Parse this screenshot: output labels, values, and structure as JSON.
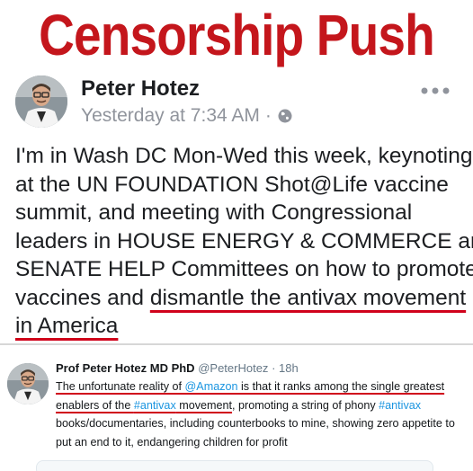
{
  "headline": {
    "text": "Censorship Push",
    "color": "#c4161c"
  },
  "facebook_post": {
    "author": "Peter Hotez",
    "timestamp": "Yesterday at 7:34 AM",
    "separator": "·",
    "privacy_icon": "globe-icon",
    "more_icon": "more-options-icon",
    "lines": [
      {
        "text": "I'm in Wash DC Mon-Wed this week, keynoting",
        "underlined": ""
      },
      {
        "text": "at the UN FOUNDATION Shot@Life vaccine",
        "underlined": ""
      },
      {
        "text": "summit, and meeting with Congressional",
        "underlined": ""
      },
      {
        "text": "leaders in HOUSE ENERGY & COMMERCE and",
        "underlined": ""
      },
      {
        "text": "SENATE HELP Committees on how to promote",
        "underlined": ""
      },
      {
        "text": "vaccines and ",
        "underlined": "dismantle the antivax movement"
      },
      {
        "text": "",
        "underlined": "in America"
      }
    ]
  },
  "tweet": {
    "name": "Prof Peter Hotez MD PhD",
    "handle": "@PeterHotez",
    "time": "· 18h",
    "line1": {
      "a": "The unfortunate reality of ",
      "mention": "@Amazon",
      "b": " is that it ranks among the single greatest"
    },
    "line2": {
      "a": "enablers of the ",
      "hashtag": "#antivax",
      "b": " movement",
      "c": ",  promoting a string of phony ",
      "hashtag2": "#antivax"
    },
    "line3": "books/documentaries, including counterbooks to mine, showing zero appetite to",
    "line4": "put an end to it, endangering children for profit"
  },
  "colors": {
    "underline": "#d0021b",
    "link": "#1b95e0",
    "meta_gray": "#90949c"
  }
}
